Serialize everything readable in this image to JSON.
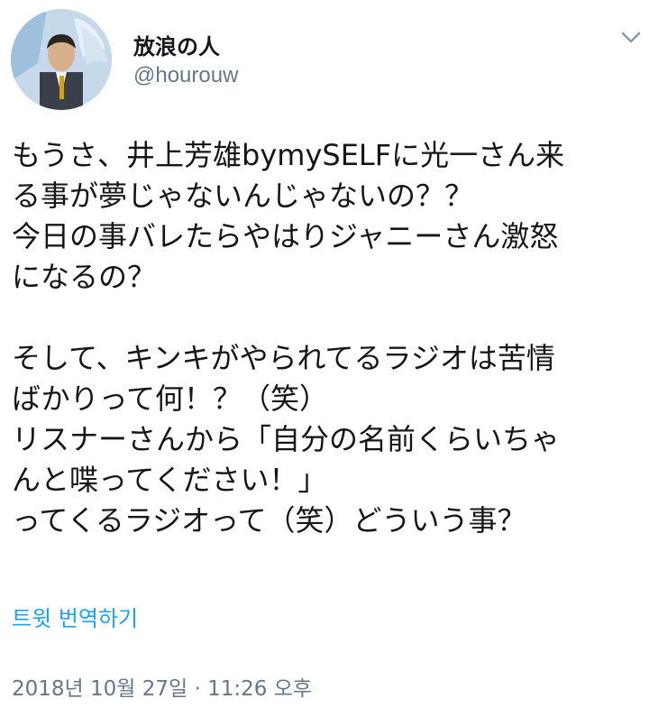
{
  "author": {
    "display_name": "放浪の人",
    "handle": "@hourouw",
    "avatar_icon": "profile-photo"
  },
  "menu": {
    "icon": "chevron-down-icon"
  },
  "tweet": {
    "lines": [
      "もうさ、井上芳雄bymySELFに光一さん来",
      "る事が夢じゃないんじゃないの？？",
      "今日の事バレたらやはりジャニーさん激怒",
      "になるの？",
      "",
      "そして、キンキがやられてるラジオは苦情",
      "ばかりって何！？（笑）",
      "リスナーさんから「自分の名前くらいちゃ",
      "んと喋ってください！」",
      "ってくるラジオって（笑）どういう事？"
    ]
  },
  "translate_link": "트윗 번역하기",
  "timestamp": "2018년 10월 27일 · 11:26 오후",
  "colors": {
    "link": "#1da1f2",
    "secondary_text": "#657786",
    "primary_text": "#14171a"
  }
}
